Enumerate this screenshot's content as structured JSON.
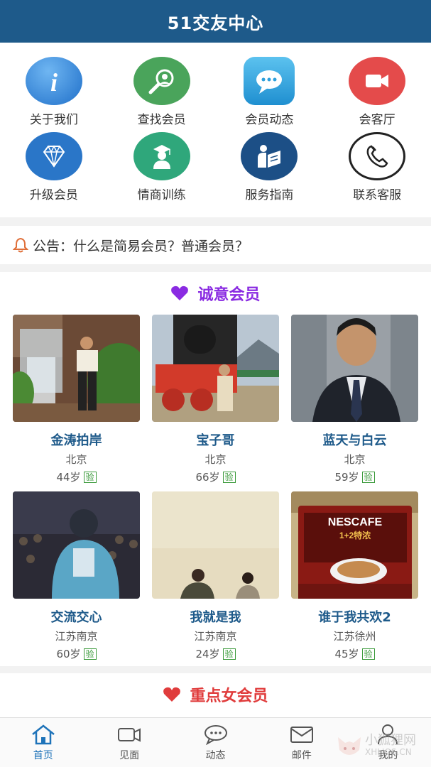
{
  "header": {
    "title": "51交友中心"
  },
  "menu": {
    "items": [
      {
        "label": "关于我们",
        "icon": "info-icon",
        "color": "#2f7fd6"
      },
      {
        "label": "查找会员",
        "icon": "search-user-icon",
        "color": "#4aa45b"
      },
      {
        "label": "会员动态",
        "icon": "chat-bubble-icon",
        "color": "#2c9fdc"
      },
      {
        "label": "会客厅",
        "icon": "video-camera-icon",
        "color": "#e44b4b"
      },
      {
        "label": "升级会员",
        "icon": "diamond-icon",
        "color": "#2a76c8"
      },
      {
        "label": "情商训练",
        "icon": "graduate-icon",
        "color": "#2fa77b"
      },
      {
        "label": "服务指南",
        "icon": "reader-icon",
        "color": "#1c4f86"
      },
      {
        "label": "联系客服",
        "icon": "phone-icon",
        "color": "#222222"
      }
    ]
  },
  "notice": {
    "text": "公告：什么是简易会员？普通会员？"
  },
  "sincere": {
    "title": "诚意会员",
    "color": "#8a2be2",
    "members": [
      {
        "name": "金涛拍岸",
        "city": "北京",
        "age": "44岁",
        "badge": "验"
      },
      {
        "name": "宝子哥",
        "city": "北京",
        "age": "66岁",
        "badge": "验"
      },
      {
        "name": "蓝天与白云",
        "city": "北京",
        "age": "59岁",
        "badge": "验"
      },
      {
        "name": "交流交心",
        "city": "江苏南京",
        "age": "60岁",
        "badge": "验"
      },
      {
        "name": "我就是我",
        "city": "江苏南京",
        "age": "24岁",
        "badge": "验"
      },
      {
        "name": "谁于我共欢2",
        "city": "江苏徐州",
        "age": "45岁",
        "badge": "验"
      }
    ]
  },
  "featured": {
    "title": "重点女会员",
    "color": "#e03c3c"
  },
  "tabbar": {
    "items": [
      {
        "label": "首页",
        "icon": "home-icon",
        "active": true
      },
      {
        "label": "见面",
        "icon": "video-icon",
        "active": false
      },
      {
        "label": "动态",
        "icon": "chat-icon",
        "active": false
      },
      {
        "label": "邮件",
        "icon": "mail-icon",
        "active": false
      },
      {
        "label": "我的",
        "icon": "user-icon",
        "active": false
      }
    ]
  },
  "watermark": {
    "text": "小狐狸网",
    "sub": "XHLJOS.CN"
  },
  "photo_texts": {
    "nescafe": "NESCAFE",
    "nescafe_sub": "1+2特浓"
  }
}
